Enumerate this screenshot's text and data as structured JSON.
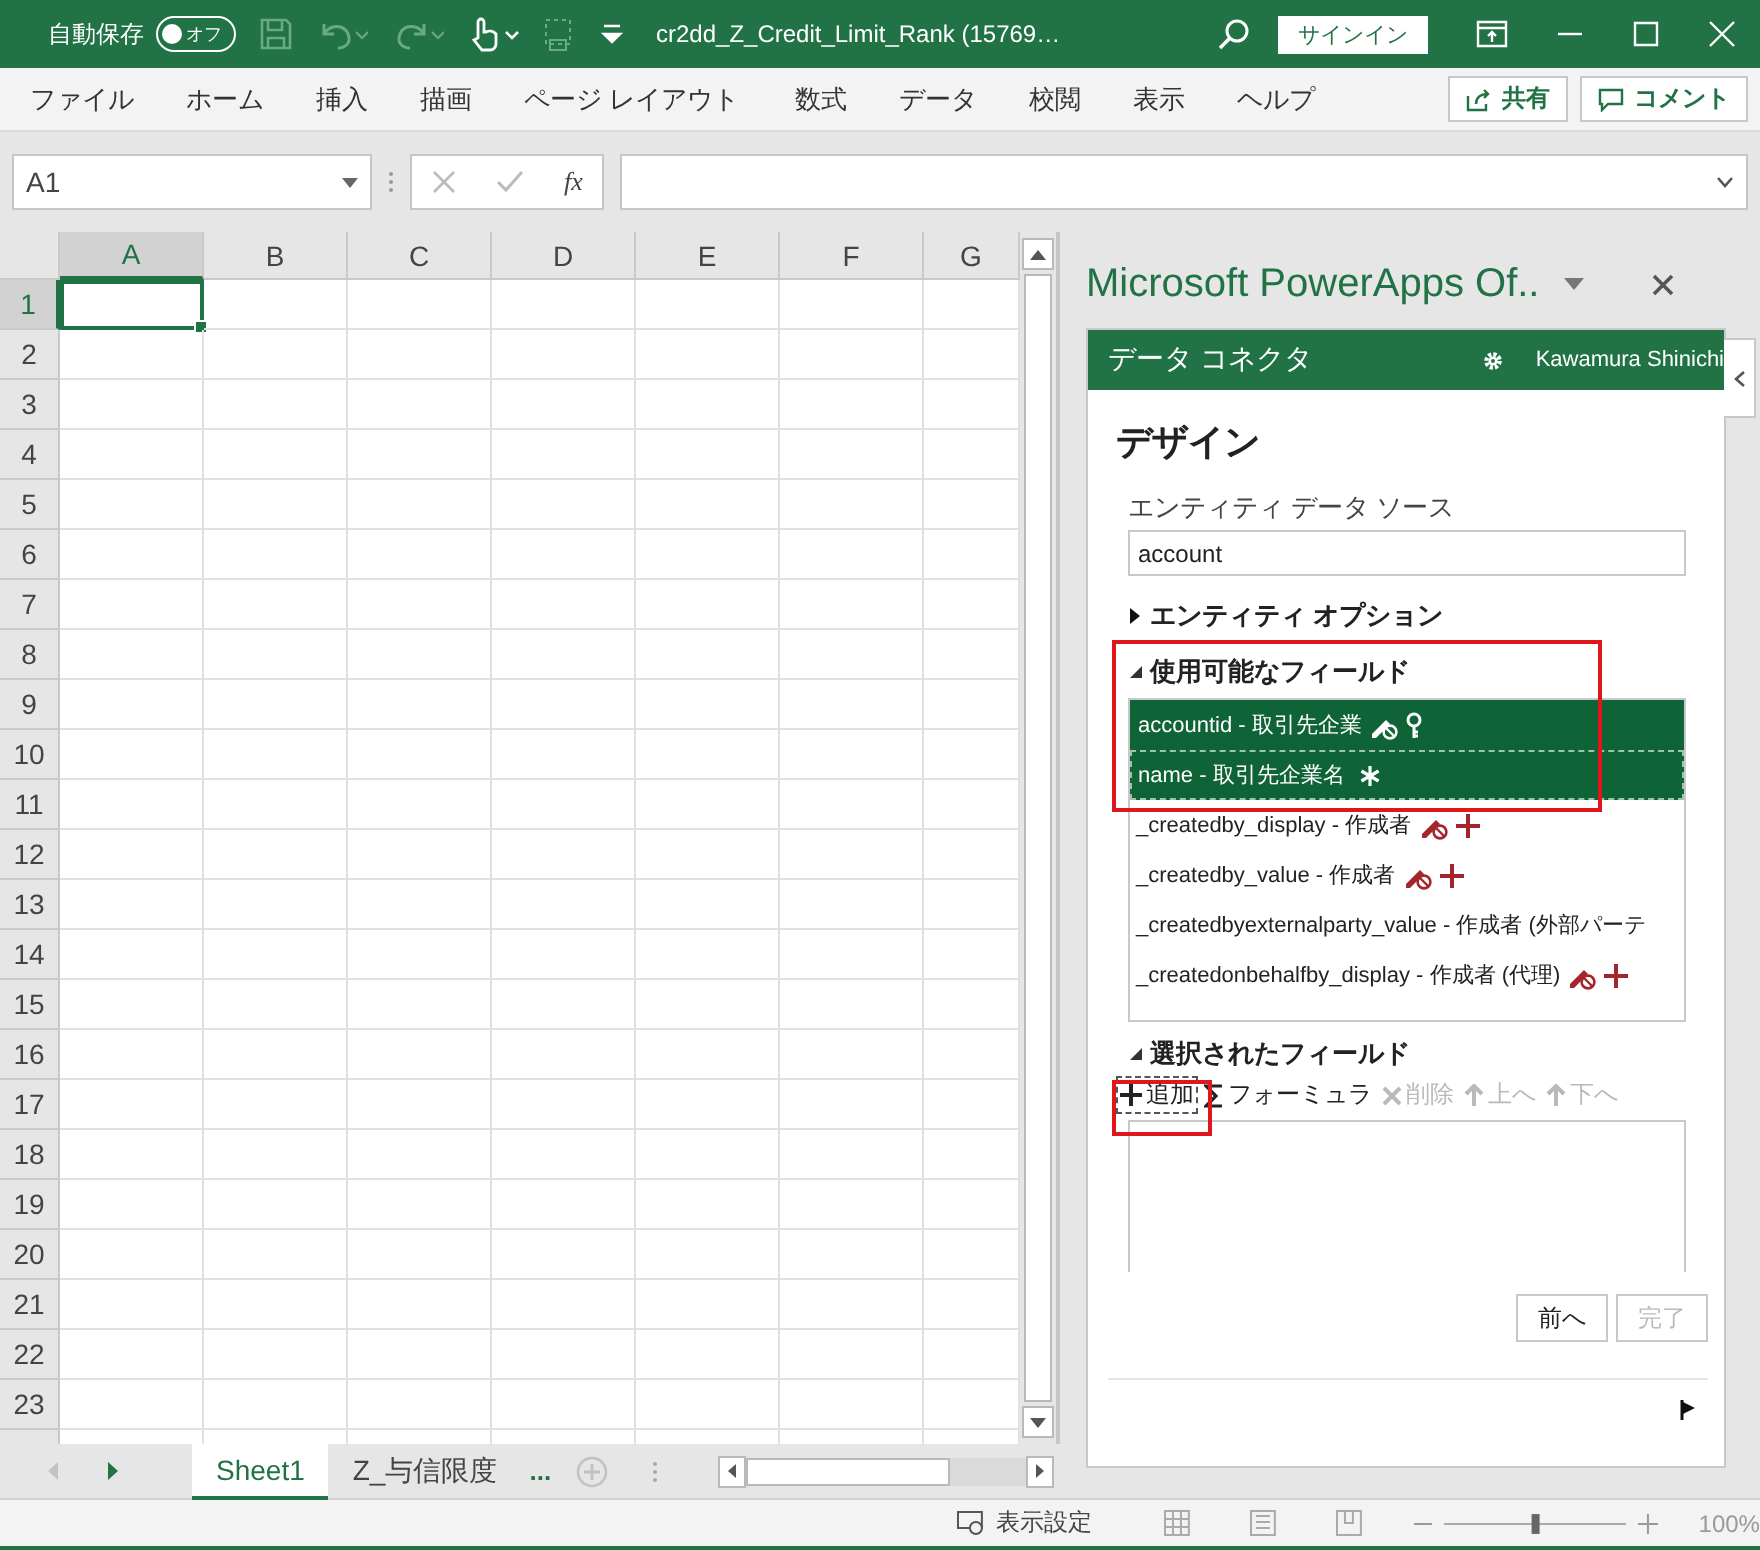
{
  "title_bar": {
    "autosave_label": "自動保存",
    "autosave_toggle": {
      "label": "オフ",
      "on": false
    },
    "filename": "cr2dd_Z_Credit_Limit_Rank (15769…",
    "signin": "サインイン"
  },
  "ribbon": {
    "tabs": [
      {
        "label": "ファイル"
      },
      {
        "label": "ホーム"
      },
      {
        "label": "挿入"
      },
      {
        "label": "描画"
      },
      {
        "label": "ページ レイアウト"
      },
      {
        "label": "数式"
      },
      {
        "label": "データ"
      },
      {
        "label": "校閲"
      },
      {
        "label": "表示"
      },
      {
        "label": "ヘルプ"
      }
    ],
    "share": "共有",
    "comment": "コメント"
  },
  "formula_bar": {
    "name_box": "A1",
    "fx": "fx"
  },
  "grid": {
    "columns": [
      {
        "label": "A",
        "selected": true
      },
      {
        "label": "B",
        "selected": false
      },
      {
        "label": "C",
        "selected": false
      },
      {
        "label": "D",
        "selected": false
      },
      {
        "label": "E",
        "selected": false
      },
      {
        "label": "F",
        "selected": false
      },
      {
        "label": "G",
        "selected": false
      }
    ],
    "rows": [
      {
        "label": "1",
        "selected": true
      },
      {
        "label": "2",
        "selected": false
      },
      {
        "label": "3",
        "selected": false
      },
      {
        "label": "4",
        "selected": false
      },
      {
        "label": "5",
        "selected": false
      },
      {
        "label": "6",
        "selected": false
      },
      {
        "label": "7",
        "selected": false
      },
      {
        "label": "8",
        "selected": false
      },
      {
        "label": "9",
        "selected": false
      },
      {
        "label": "10",
        "selected": false
      },
      {
        "label": "11",
        "selected": false
      },
      {
        "label": "12",
        "selected": false
      },
      {
        "label": "13",
        "selected": false
      },
      {
        "label": "14",
        "selected": false
      },
      {
        "label": "15",
        "selected": false
      },
      {
        "label": "16",
        "selected": false
      },
      {
        "label": "17",
        "selected": false
      },
      {
        "label": "18",
        "selected": false
      },
      {
        "label": "19",
        "selected": false
      },
      {
        "label": "20",
        "selected": false
      },
      {
        "label": "21",
        "selected": false
      },
      {
        "label": "22",
        "selected": false
      },
      {
        "label": "23",
        "selected": false
      }
    ]
  },
  "sheet_tabs": {
    "tabs": [
      {
        "label": "Sheet1",
        "selected": true
      },
      {
        "label": "Z_与信限度",
        "selected": false
      }
    ],
    "more": "..."
  },
  "status_bar": {
    "display_settings": "表示設定",
    "zoom_slider": {
      "level": 0.5
    },
    "zoom": "100%"
  },
  "pane": {
    "title": "Microsoft PowerApps Of..",
    "header": "データ コネクタ",
    "user": "Kawamura Shinichi",
    "heading": "デザイン",
    "source_label": "エンティティ データ ソース",
    "source_value": "account",
    "sections": [
      {
        "title": "エンティティ オプション",
        "expanded": false
      },
      {
        "title": "使用可能なフィールド",
        "expanded": true,
        "highlighted": true
      },
      {
        "title": "選択されたフィールド",
        "expanded": true,
        "highlighted": false
      }
    ],
    "available_fields": [
      {
        "label": "accountid - 取引先企業",
        "selected": true,
        "focused": false,
        "locked": true,
        "kind": "key"
      },
      {
        "label": "name - 取引先企業名",
        "selected": true,
        "focused": true,
        "locked": false,
        "kind": "required"
      },
      {
        "label": "_createdby_display - 作成者",
        "selected": false,
        "focused": false,
        "locked": true,
        "kind": "custom"
      },
      {
        "label": "_createdby_value - 作成者",
        "selected": false,
        "focused": false,
        "locked": true,
        "kind": "custom"
      },
      {
        "label": "_createdbyexternalparty_value - 作成者 (外部パーテ",
        "selected": false,
        "focused": false,
        "locked": false,
        "kind": "plain"
      },
      {
        "label": "_createdonbehalfby_display - 作成者 (代理)",
        "selected": false,
        "focused": false,
        "locked": true,
        "kind": "custom"
      }
    ],
    "toolbar": [
      {
        "kind": "add",
        "label": "追加",
        "disabled": false,
        "highlighted": true
      },
      {
        "kind": "formula",
        "label": "フォーミュラ",
        "disabled": false,
        "highlighted": false
      },
      {
        "kind": "delete",
        "label": "削除",
        "disabled": true,
        "highlighted": false
      },
      {
        "kind": "up",
        "label": "上へ",
        "disabled": true,
        "highlighted": false
      },
      {
        "kind": "down",
        "label": "下へ",
        "disabled": true,
        "highlighted": false
      }
    ],
    "buttons": [
      {
        "label": "前へ",
        "disabled": false
      },
      {
        "label": "完了",
        "disabled": true
      }
    ]
  }
}
